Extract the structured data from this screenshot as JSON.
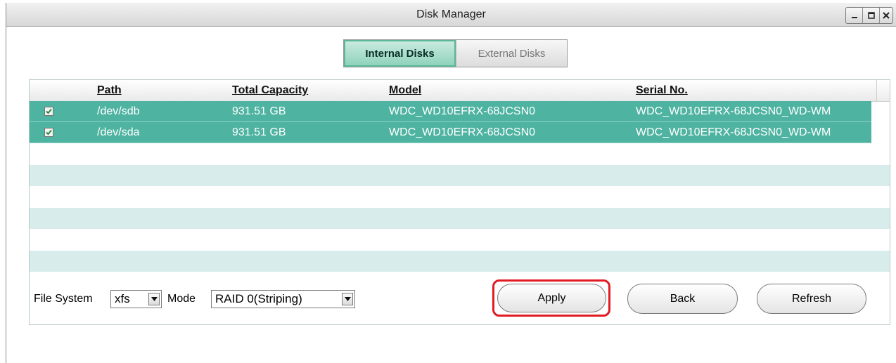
{
  "window": {
    "title": "Disk Manager",
    "controls": [
      "minimize-icon",
      "maximize-icon",
      "close-icon"
    ]
  },
  "tabs": [
    {
      "label": "Internal Disks",
      "active": true
    },
    {
      "label": "External Disks",
      "active": false
    }
  ],
  "table": {
    "columns": [
      "Path",
      "Total Capacity",
      "Model",
      "Serial No."
    ],
    "rows": [
      {
        "checked": true,
        "path": "/dev/sdb",
        "capacity": "931.51 GB",
        "model": "WDC_WD10EFRX-68JCSN0",
        "serial": "WDC_WD10EFRX-68JCSN0_WD-WM"
      },
      {
        "checked": true,
        "path": "/dev/sda",
        "capacity": "931.51 GB",
        "model": "WDC_WD10EFRX-68JCSN0",
        "serial": "WDC_WD10EFRX-68JCSN0_WD-WM"
      }
    ]
  },
  "footer": {
    "file_system_label": "File System",
    "file_system_value": "xfs",
    "mode_label": "Mode",
    "mode_value": "RAID 0(Striping)",
    "apply_label": "Apply",
    "back_label": "Back",
    "refresh_label": "Refresh"
  },
  "colors": {
    "selected_row": "#4fb3a1",
    "active_tab": "#8fd3bd",
    "stripe": "#d9ecec",
    "highlight": "#e11b22"
  }
}
